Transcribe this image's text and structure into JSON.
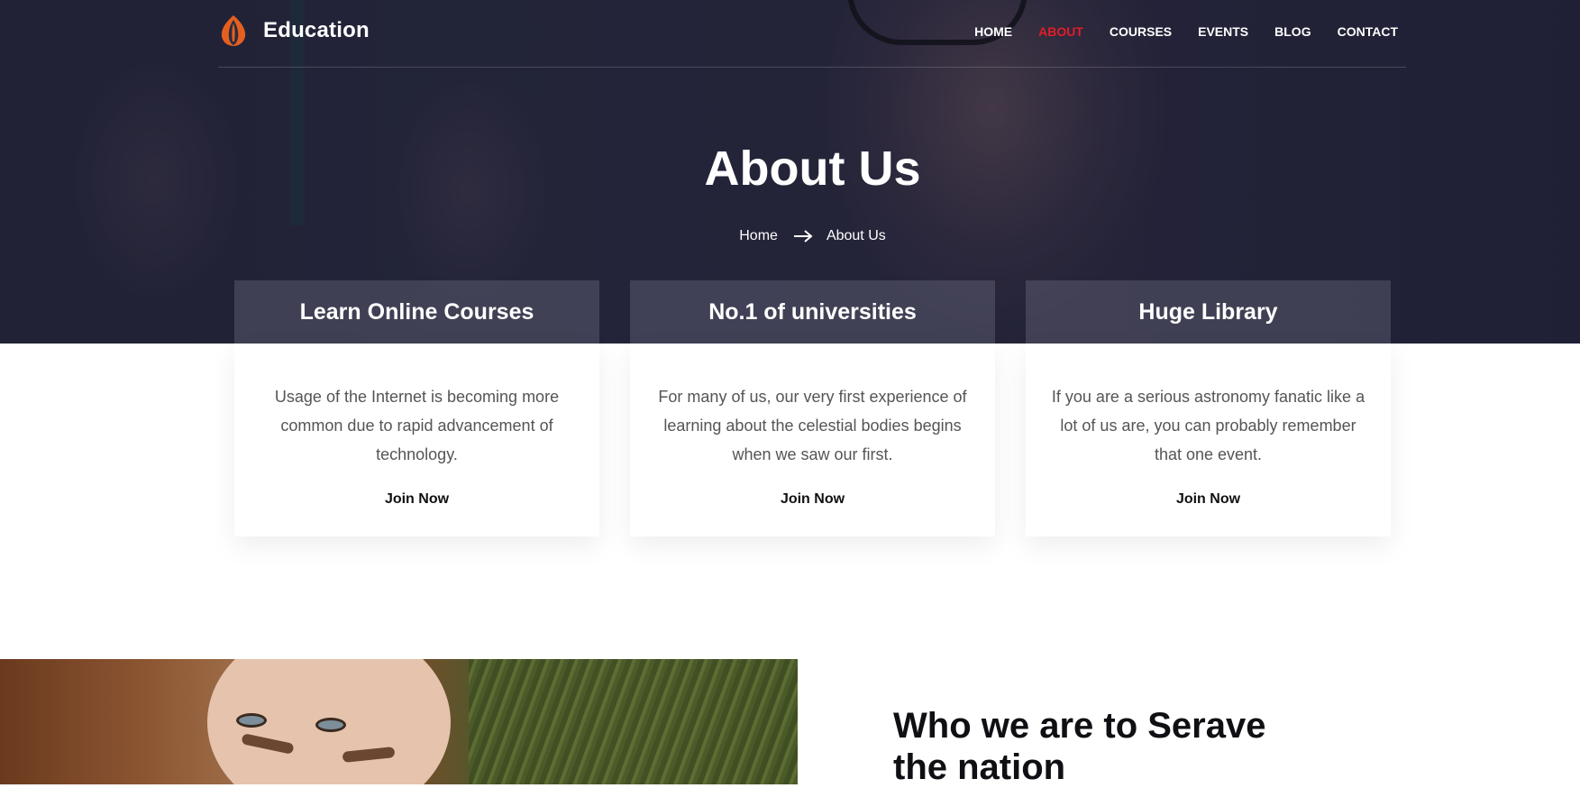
{
  "brand": {
    "name": "Education",
    "logo_icon": "flame-logo-icon",
    "accent": "#e5601f"
  },
  "nav": {
    "items": [
      {
        "label": "HOME"
      },
      {
        "label": "ABOUT"
      },
      {
        "label": "COURSES"
      },
      {
        "label": "EVENTS"
      },
      {
        "label": "BLOG"
      },
      {
        "label": "CONTACT"
      }
    ],
    "active_color": "#e11d29"
  },
  "hero": {
    "title": "About Us",
    "breadcrumb": {
      "home": "Home",
      "current": "About Us",
      "separator_icon": "arrow-right-icon"
    }
  },
  "features": [
    {
      "title": "Learn Online Courses",
      "text": "Usage of the Internet is becoming more common due to rapid advancement of technology.",
      "link": "Join Now"
    },
    {
      "title": "No.1 of universities",
      "text": "For many of us, our very first experience of learning about the celestial bodies begins when we saw our first.",
      "link": "Join Now"
    },
    {
      "title": "Huge Library",
      "text": "If you are a serious astronomy fanatic like a lot of us are, you can probably remember that one event.",
      "link": "Join Now"
    }
  ],
  "about": {
    "title": "Who we are to Serave the nation"
  }
}
